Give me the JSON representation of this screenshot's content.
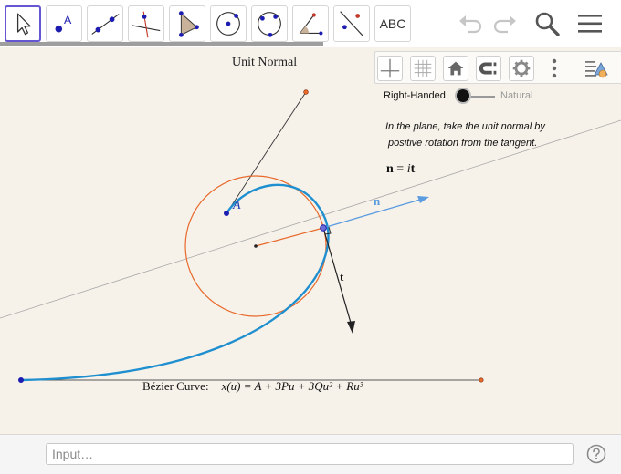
{
  "toolbar": {
    "tools": [
      {
        "name": "move-tool-icon"
      },
      {
        "name": "point-tool-icon"
      },
      {
        "name": "line-tool-icon"
      },
      {
        "name": "perpendicular-line-tool-icon"
      },
      {
        "name": "polygon-tool-icon"
      },
      {
        "name": "circle-center-point-tool-icon"
      },
      {
        "name": "circle-three-points-tool-icon"
      },
      {
        "name": "angle-tool-icon"
      },
      {
        "name": "reflect-tool-icon"
      },
      {
        "name": "text-tool-icon",
        "label": "ABC"
      }
    ],
    "point_tool_label": "A",
    "right_icons": [
      "undo-icon",
      "redo-icon",
      "search-icon",
      "menu-icon"
    ]
  },
  "style_bar": {
    "buttons": [
      "axes-toggle-icon",
      "grid-toggle-icon",
      "home-icon",
      "point-capturing-icon",
      "settings-gear-icon",
      "more-vertical-icon",
      "style-bar-toggle-icon"
    ]
  },
  "graphics": {
    "title": "Unit Normal",
    "toggle": {
      "left_label": "Right-Handed",
      "right_label": "Natural",
      "selected": "Right-Handed"
    },
    "note_line1": "In the plane,  take the unit normal by",
    "note_line2": "positive rotation from the tangent.",
    "formula_lhs": "n",
    "formula_eq": " = ",
    "formula_rhs_i": "i",
    "formula_rhs_t": "t",
    "point_label": "A",
    "normal_label": "n",
    "tangent_label": "t",
    "bezier_prefix": "Bézier Curve:",
    "bezier_equation": "x(u) = A + 3Pu + 3Qu² + Ru³",
    "colors": {
      "curve": "#1f8fcf",
      "circle": "#e8692a",
      "normal_vector": "#5b9be0",
      "point": "#1c1cb0",
      "background": "#f6f2ea"
    }
  },
  "input": {
    "placeholder": "Input…",
    "value": ""
  },
  "help_icon": "help-circle-icon"
}
